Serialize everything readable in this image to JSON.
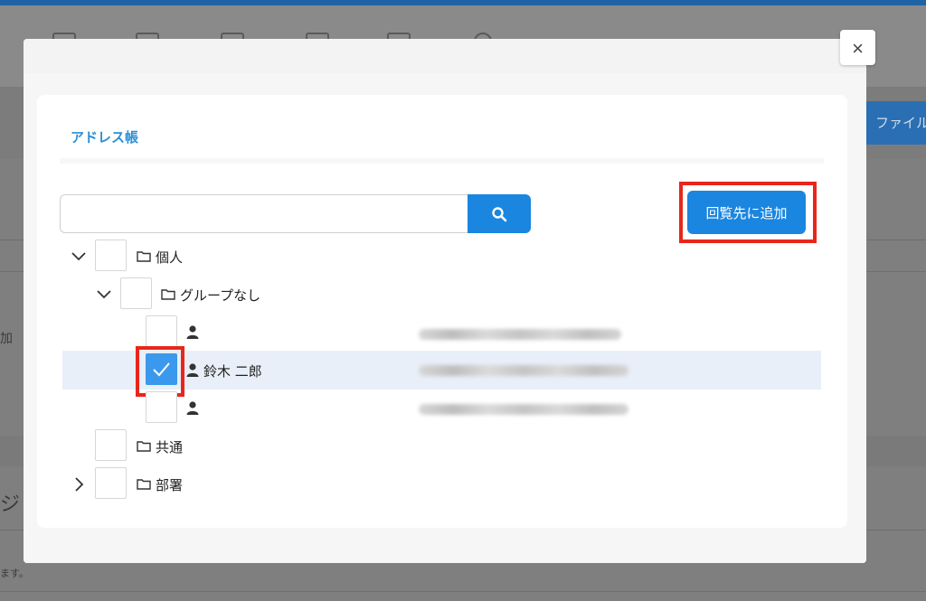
{
  "background": {
    "left_text_1": "加",
    "left_text_2": "ジ",
    "left_text_3": "ます。",
    "file_button": "ファイル"
  },
  "modal": {
    "close_symbol": "×",
    "title": "アドレス帳",
    "search": {
      "value": "",
      "placeholder": ""
    },
    "add_button_label": "回覧先に追加",
    "tree": {
      "personal": "個人",
      "no_group": "グループなし",
      "contact_selected": "鈴木 二郎",
      "common": "共通",
      "department": "部署"
    }
  },
  "colors": {
    "accent": "#1a86e0",
    "highlight": "#e8261b",
    "selected_row": "#e8eff8",
    "title": "#2b8fd6"
  },
  "icons": [
    "search-icon",
    "close-icon",
    "folder-icon",
    "user-icon",
    "chevron-down-icon",
    "chevron-right-icon",
    "check-icon"
  ]
}
